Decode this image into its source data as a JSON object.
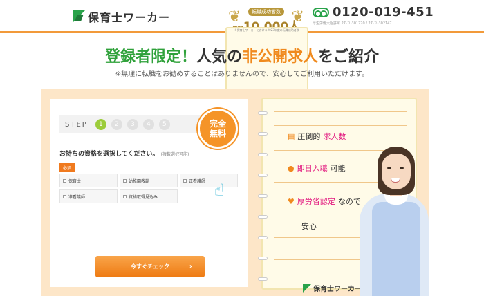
{
  "header": {
    "brand": "保育士ワーカー",
    "award_title": "転職成功者数",
    "award_prefix": "年間",
    "award_value": "10,000人",
    "award_note": "※保育士ワーカーにおける2023年度の転職成功者数",
    "phone": "0120-019-451",
    "license": "厚生労働大臣許可 27-ユ-301770 / 27-ユ-302147"
  },
  "headline": {
    "p1": "登録者限定！",
    "p2": "人気の",
    "p3": "非公開求人",
    "p4": "をご紹介"
  },
  "subnote": "※無理に転職をお勧めすることはありませんので、安心してご利用いただけます。",
  "form": {
    "step_label": "STEP",
    "steps": [
      "1",
      "2",
      "3",
      "4",
      "5"
    ],
    "badge_line1": "完全",
    "badge_line2": "無料",
    "question": "お持ちの資格を選択してください。",
    "question_note": "(複数選択可能)",
    "required": "必須",
    "options": [
      "保育士",
      "幼稚園教諭",
      "正看護師",
      "准看護師",
      "資格取得見込み"
    ],
    "cta": "今すぐチェック"
  },
  "notebook": {
    "feat1_a": "圧倒的",
    "feat1_b": "求人数",
    "feat2_a": "即日入職",
    "feat2_b": "可能",
    "feat3_a": "厚労省認定",
    "feat3_b": "なので",
    "feat3_c": "安心",
    "logo": "保育士ワーカー"
  },
  "colors": {
    "brand_green": "#2fa13a",
    "accent_orange": "#f08a1e",
    "highlight_pink": "#e2197f",
    "stage_bg": "#fde6c8"
  }
}
